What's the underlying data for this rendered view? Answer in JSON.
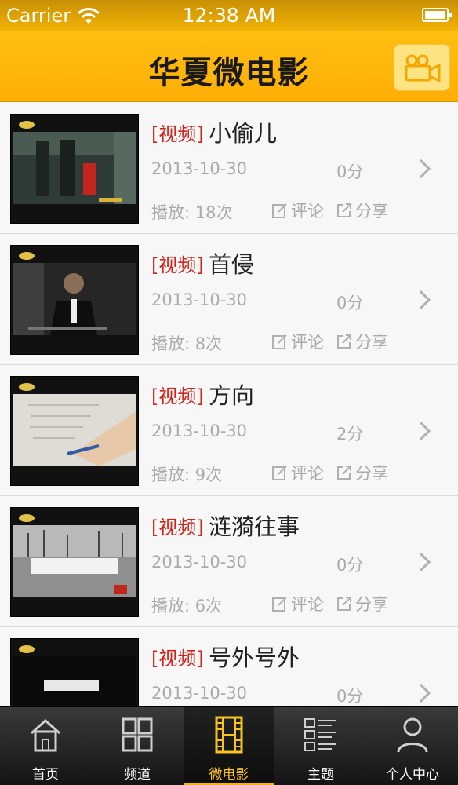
{
  "status_bar": {
    "carrier": "Carrier",
    "time": "12:38 AM"
  },
  "nav_bar": {
    "title": "华夏微电影"
  },
  "videos": [
    {
      "tag": "[视频]",
      "title": "小偷儿",
      "date": "2013-10-30",
      "score": "0分",
      "plays": "播放: 18次",
      "comment": "评论",
      "share": "分享"
    },
    {
      "tag": "[视频]",
      "title": "首侵",
      "date": "2013-10-30",
      "score": "0分",
      "plays": "播放: 8次",
      "comment": "评论",
      "share": "分享"
    },
    {
      "tag": "[视频]",
      "title": "方向",
      "date": "2013-10-30",
      "score": "2分",
      "plays": "播放: 9次",
      "comment": "评论",
      "share": "分享"
    },
    {
      "tag": "[视频]",
      "title": "涟漪往事",
      "date": "2013-10-30",
      "score": "0分",
      "plays": "播放: 6次",
      "comment": "评论",
      "share": "分享"
    },
    {
      "tag": "[视频]",
      "title": "号外号外",
      "date": "2013-10-30",
      "score": "0分",
      "plays": "",
      "comment": "",
      "share": ""
    }
  ],
  "tabs": [
    {
      "label": "首页",
      "icon": "home-icon"
    },
    {
      "label": "频道",
      "icon": "grid-icon"
    },
    {
      "label": "微电影",
      "icon": "film-icon",
      "active": true
    },
    {
      "label": "主题",
      "icon": "list-icon"
    },
    {
      "label": "个人中心",
      "icon": "user-icon"
    }
  ],
  "colors": {
    "accent": "#ffb30b",
    "tag_red": "#d2231a",
    "active_tab": "#f7c31c"
  }
}
